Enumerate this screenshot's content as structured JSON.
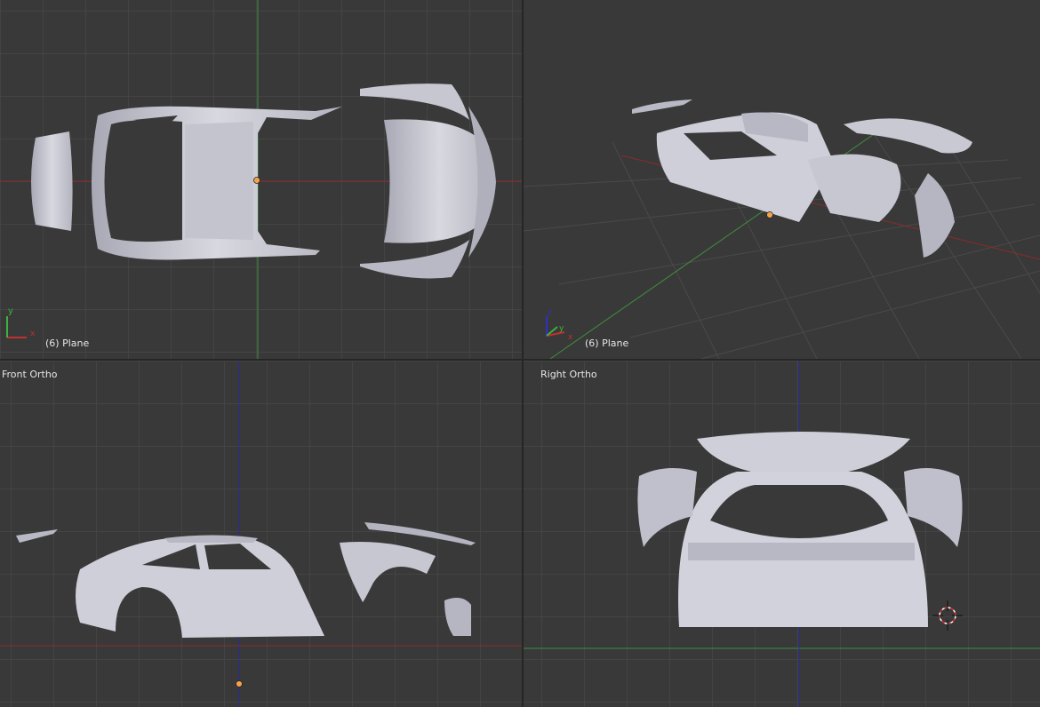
{
  "viewports": {
    "top": {
      "object_label": "(6) Plane",
      "axes": {
        "axis1": "y",
        "axis2": "x"
      }
    },
    "perspective": {
      "object_label": "(6) Plane",
      "axes": {
        "axis1": "z",
        "axis2": "y",
        "axis3": "x"
      }
    },
    "front": {
      "label": "Front Ortho"
    },
    "right": {
      "label": "Right Ortho"
    }
  },
  "colors": {
    "background": "#393939",
    "grid": "#444444",
    "axis_x": "#8b2b2b",
    "axis_y": "#3f8f3f",
    "axis_z": "#2b2b9b",
    "mesh": "#c9c9d4",
    "origin": "#f5a04a"
  },
  "icons": {
    "origin": "origin-dot-icon",
    "cursor": "3d-cursor-icon",
    "axes": "axes-gizmo-icon"
  }
}
